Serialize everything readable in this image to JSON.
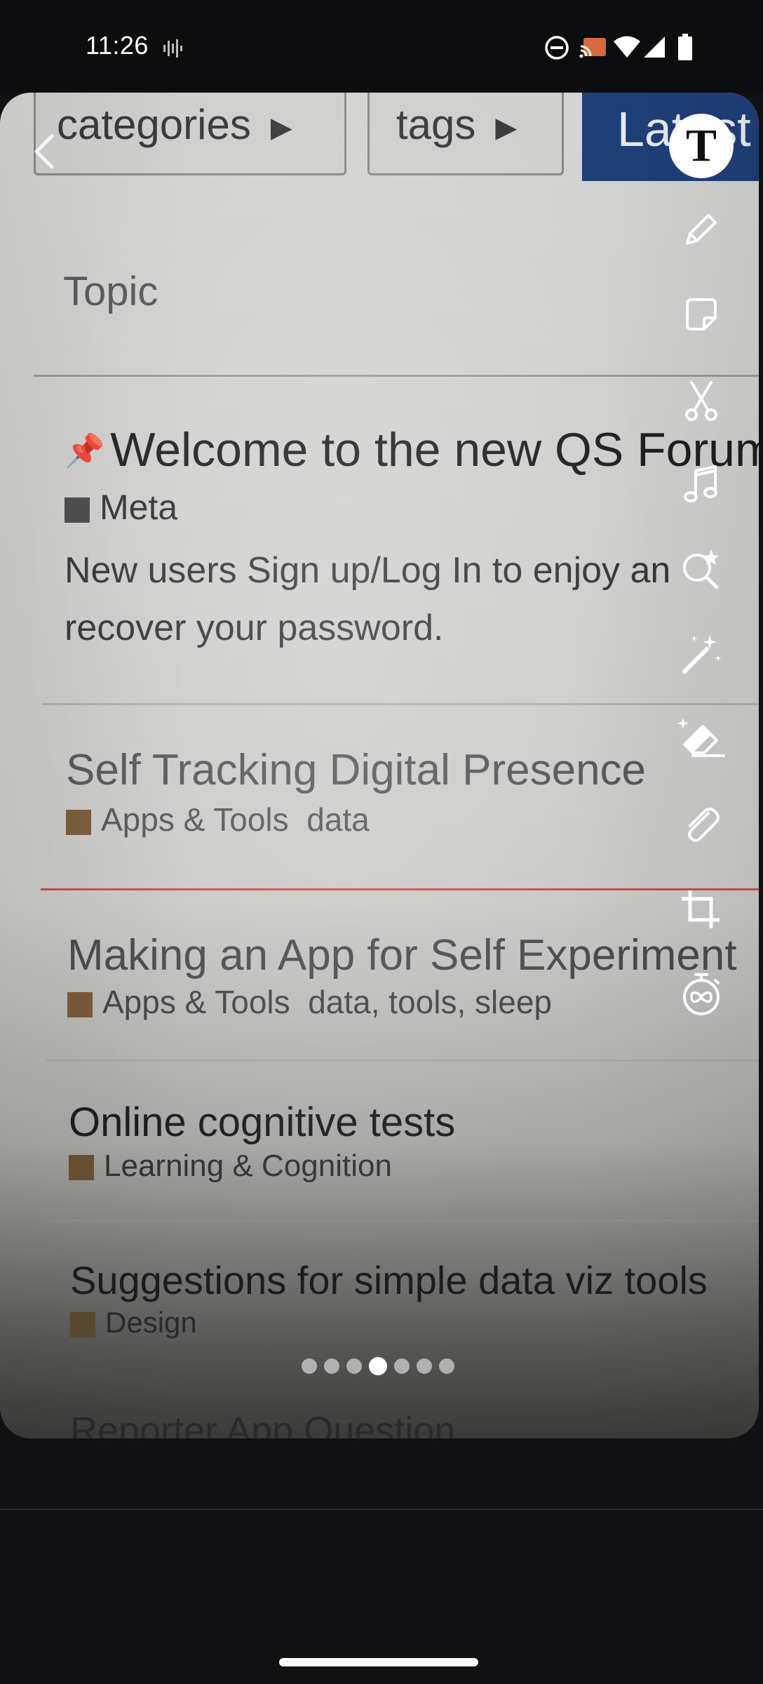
{
  "status_bar": {
    "time": "11:26",
    "icons": [
      "audio-waveform-icon",
      "do-not-disturb-icon",
      "cast-icon",
      "wifi-icon",
      "cellular-signal-icon",
      "battery-icon"
    ]
  },
  "photo": {
    "pills": {
      "categories": "categories",
      "tags": "tags",
      "latest": "Latest"
    },
    "column_header": "Topic",
    "topics": [
      {
        "title": "Welcome to the new QS Forum",
        "pinned": true,
        "category": "Meta",
        "category_color": "#4a4a4a",
        "tags": "",
        "description_line1": "New users Sign up/Log In to enjoy an",
        "description_line2": "recover your password."
      },
      {
        "title": "Self Tracking Digital Presence",
        "category": "Apps & Tools",
        "category_color": "#7a5a3a",
        "tags": "data"
      },
      {
        "title": "Making an App for Self Experiment",
        "category": "Apps & Tools",
        "category_color": "#7a5a3a",
        "tags": "data, tools, sleep"
      },
      {
        "title": "Online cognitive tests",
        "category": "Learning & Cognition",
        "category_color": "#6a5030",
        "tags": ""
      },
      {
        "title": "Suggestions for simple data viz tools",
        "category": "Design",
        "category_color": "#5a4a30",
        "tags": ""
      },
      {
        "title": "Reporter App Question",
        "category": "",
        "tags": ""
      }
    ]
  },
  "editor_tools": [
    "text-tool",
    "draw-tool",
    "sticker-tool",
    "scissors-tool",
    "music-tool",
    "lens-tool",
    "magic-wand-tool",
    "eraser-tool",
    "attachment-tool",
    "crop-tool",
    "timer-tool"
  ],
  "text_tool_glyph": "T",
  "pager": {
    "count": 7,
    "active_index": 3
  },
  "colors": {
    "accent_latest": "#1f3f78",
    "divider_red": "#c0504d",
    "background": "#111113"
  }
}
